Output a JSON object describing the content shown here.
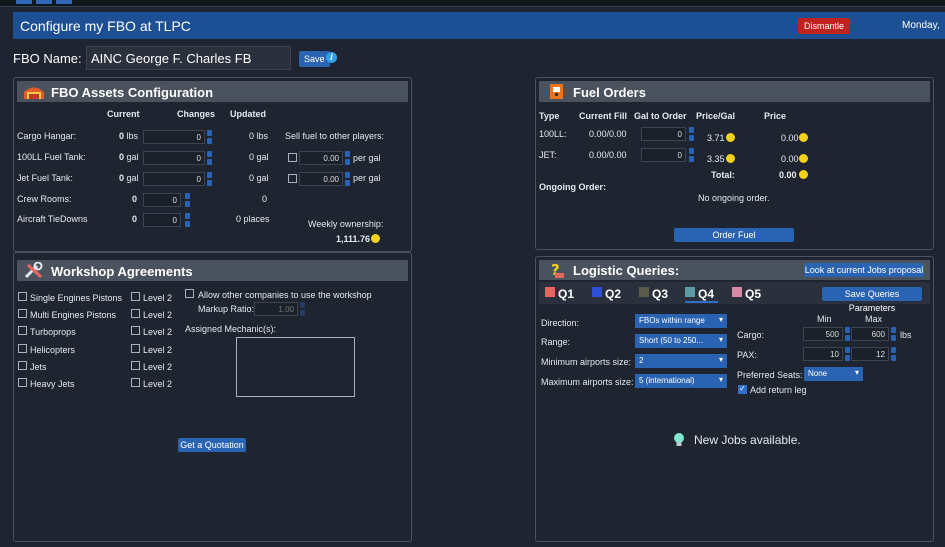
{
  "header": {
    "title": "Configure my FBO at TLPC",
    "dismantle_label": "Dismantle",
    "date": "Monday, "
  },
  "fbo": {
    "label": "FBO Name:",
    "name_value": "AINC George F. Charles FB",
    "save_label": "Save",
    "info_symbol": "i"
  },
  "assets": {
    "title": "FBO Assets Configuration",
    "col_current": "Current",
    "col_changes": "Changes",
    "col_updated": "Updated",
    "rows": [
      {
        "label": "Cargo Hangar:",
        "current": "0",
        "current_unit": "lbs",
        "change": "0",
        "updated": "0 lbs"
      },
      {
        "label": "100LL Fuel Tank:",
        "current": "0",
        "current_unit": "gal",
        "change": "0",
        "updated": "0 gal"
      },
      {
        "label": "Jet Fuel Tank:",
        "current": "0",
        "current_unit": "gal",
        "change": "0",
        "updated": "0 gal"
      },
      {
        "label": "Crew Rooms:",
        "current": "0",
        "current_unit": "",
        "change": "0",
        "updated": "0"
      },
      {
        "label": "Aircraft TieDowns",
        "current": "0",
        "current_unit": "",
        "change": "0",
        "updated": "0 places"
      }
    ],
    "sell_label": "Sell fuel to other players:",
    "sell_100ll_value": "0.00",
    "sell_jet_value": "0.00",
    "per_gal": "per gal",
    "weekly_label": "Weekly ownership:",
    "weekly_value": "1,111.76"
  },
  "workshop": {
    "title": "Workshop Agreements",
    "items": [
      "Single Engines Pistons",
      "Multi Engines Pistons",
      "Turboprops",
      "Helicopters",
      "Jets",
      "Heavy Jets"
    ],
    "level_label": "Level 2",
    "allow_label": "Allow other companies to use the workshop",
    "markup_label": "Markup Ratio:",
    "markup_value": "1.00",
    "mechanics_label": "Assigned Mechanic(s):",
    "quote_label": "Get a Quotation"
  },
  "fuel": {
    "title": "Fuel Orders",
    "col_type": "Type",
    "col_fill": "Current Fill",
    "col_gal": "Gal to Order",
    "col_price": "Price/Gal",
    "col_total": "Price",
    "rows": [
      {
        "type": "100LL:",
        "fill": "0.00/0.00",
        "gal": "0",
        "price": "3.71",
        "total": "0.00"
      },
      {
        "type": "JET:",
        "fill": "0.00/0.00",
        "gal": "0",
        "price": "3.35",
        "total": "0.00"
      }
    ],
    "total_label": "Total:",
    "total_value": "0.00",
    "ongoing_label": "Ongoing Order:",
    "no_ongoing": "No ongoing order.",
    "order_label": "Order Fuel"
  },
  "logistic": {
    "title": "Logistic Queries:",
    "look_label": "Look at current Jobs proposal",
    "save_params_label": "Save Queries Parameters",
    "tabs": [
      {
        "label": "Q1",
        "color": "#e8675c"
      },
      {
        "label": "Q2",
        "color": "#2f4fd6"
      },
      {
        "label": "Q3",
        "color": "#5a5a4a"
      },
      {
        "label": "Q4",
        "color": "#5c9aa6"
      },
      {
        "label": "Q5",
        "color": "#d48aa3"
      }
    ],
    "direction_label": "Direction:",
    "direction_value": "FBOs within range",
    "range_label": "Range:",
    "range_value": "Short (50 to 250...",
    "min_size_label": "Minimum airports size:",
    "min_size_value": "2",
    "max_size_label": "Maximum airports size:",
    "max_size_value": "5 (international)",
    "min_label": "Min",
    "max_label": "Max",
    "cargo_label": "Cargo:",
    "cargo_min": "500",
    "cargo_max": "600",
    "cargo_unit": "lbs",
    "pax_label": "PAX:",
    "pax_min": "10",
    "pax_max": "12",
    "seats_label": "Preferred Seats:",
    "seats_value": "None",
    "return_label": "Add return leg",
    "new_jobs": "New Jobs available."
  }
}
